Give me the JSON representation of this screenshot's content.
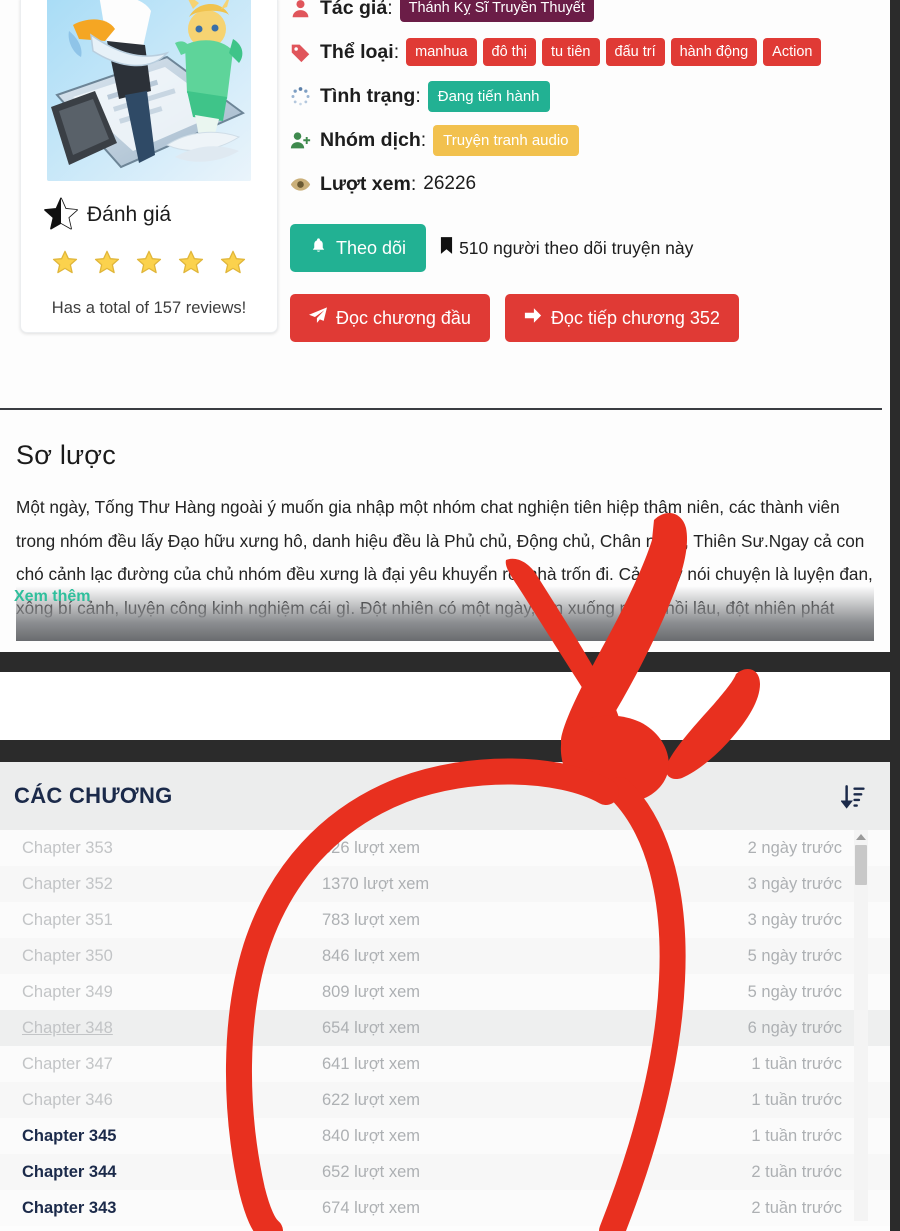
{
  "info": {
    "author": {
      "icon": "user-icon",
      "label": "Tác giả",
      "value": "Thánh Kỵ Sĩ Truyền Thuyết"
    },
    "genres": {
      "icon": "tag-icon",
      "label": "Thể loại",
      "values": [
        "manhua",
        "đô thị",
        "tu tiên",
        "đấu trí",
        "hành động",
        "Action"
      ]
    },
    "status": {
      "icon": "spinner-icon",
      "label": "Tình trạng",
      "value": "Đang tiến hành"
    },
    "team": {
      "icon": "user-plus-icon",
      "label": "Nhóm dịch",
      "value": "Truyện tranh audio"
    },
    "views": {
      "icon": "eye-icon",
      "label": "Lượt xem",
      "value": "26226"
    }
  },
  "actions": {
    "follow_label": "Theo dõi",
    "follow_icon": "bell-icon",
    "followers_text": "510 người theo dõi truyện này",
    "followers_icon": "bookmark-icon",
    "read_first_label": "Đọc chương đầu",
    "read_first_icon": "paper-plane-icon",
    "read_continue_label": "Đọc tiếp chương 352",
    "read_continue_icon": "arrow-right-icon"
  },
  "rating": {
    "heading": "Đánh giá",
    "heading_icon": "half-star-icon",
    "stars": 5,
    "reviews_text": "Has a total of 157 reviews!"
  },
  "summary": {
    "heading": "Sơ lược",
    "text": "Một ngày, Tống Thư Hàng ngoài ý muốn gia nhập một nhóm chat nghiện tiên hiệp thâm niên, các thành viên trong nhóm đều lấy Đạo hữu xưng hô, danh hiệu đều là Phủ chủ, Động chủ, Chân nhân, Thiên Sư.Ngay cả con chó cảnh lạc đường của chủ nhóm đều xưng là đại yêu khuyển rời nhà trốn đi. Cả ngày nói chuyện là luyện đan, xông bí cảnh, luyện công kinh nghiệm cái gì. Đột nhiên có một ngày, lăn xuống nước hồi lâu, đột nhiên phát",
    "more_label": "Xem thêm"
  },
  "chapters": {
    "heading": "CÁC CHƯƠNG",
    "sort_icon": "sort-amount-down-icon",
    "views_suffix": "lượt xem",
    "rows": [
      {
        "name": "Chapter 353",
        "views": "826 lượt xem",
        "time": "2 ngày trước",
        "read": true,
        "hovered": false
      },
      {
        "name": "Chapter 352",
        "views": "1370 lượt xem",
        "time": "3 ngày trước",
        "read": true,
        "hovered": false
      },
      {
        "name": "Chapter 351",
        "views": "783 lượt xem",
        "time": "3 ngày trước",
        "read": true,
        "hovered": false
      },
      {
        "name": "Chapter 350",
        "views": "846 lượt xem",
        "time": "5 ngày trước",
        "read": true,
        "hovered": false
      },
      {
        "name": "Chapter 349",
        "views": "809 lượt xem",
        "time": "5 ngày trước",
        "read": true,
        "hovered": false
      },
      {
        "name": "Chapter 348",
        "views": "654 lượt xem",
        "time": "6 ngày trước",
        "read": true,
        "hovered": true
      },
      {
        "name": "Chapter 347",
        "views": "641 lượt xem",
        "time": "1 tuần trước",
        "read": true,
        "hovered": false
      },
      {
        "name": "Chapter 346",
        "views": "622 lượt xem",
        "time": "1 tuần trước",
        "read": true,
        "hovered": false
      },
      {
        "name": "Chapter 345",
        "views": "840 lượt xem",
        "time": "1 tuần trước",
        "read": false,
        "hovered": false
      },
      {
        "name": "Chapter 344",
        "views": "652 lượt xem",
        "time": "2 tuần trước",
        "read": false,
        "hovered": false
      },
      {
        "name": "Chapter 343",
        "views": "674 lượt xem",
        "time": "2 tuần trước",
        "read": false,
        "hovered": false
      }
    ]
  },
  "annotation": {
    "type": "hand-drawn-arrow-and-circle",
    "color": "#e8301f"
  },
  "colors": {
    "accent_red": "#e03a35",
    "accent_teal": "#22b193",
    "author_badge": "#6b1d47",
    "team_badge": "#f2c14e",
    "chapter_header_bg": "#eceded",
    "page_bg": "#2b2b2b",
    "annotation_red": "#e8301f"
  }
}
